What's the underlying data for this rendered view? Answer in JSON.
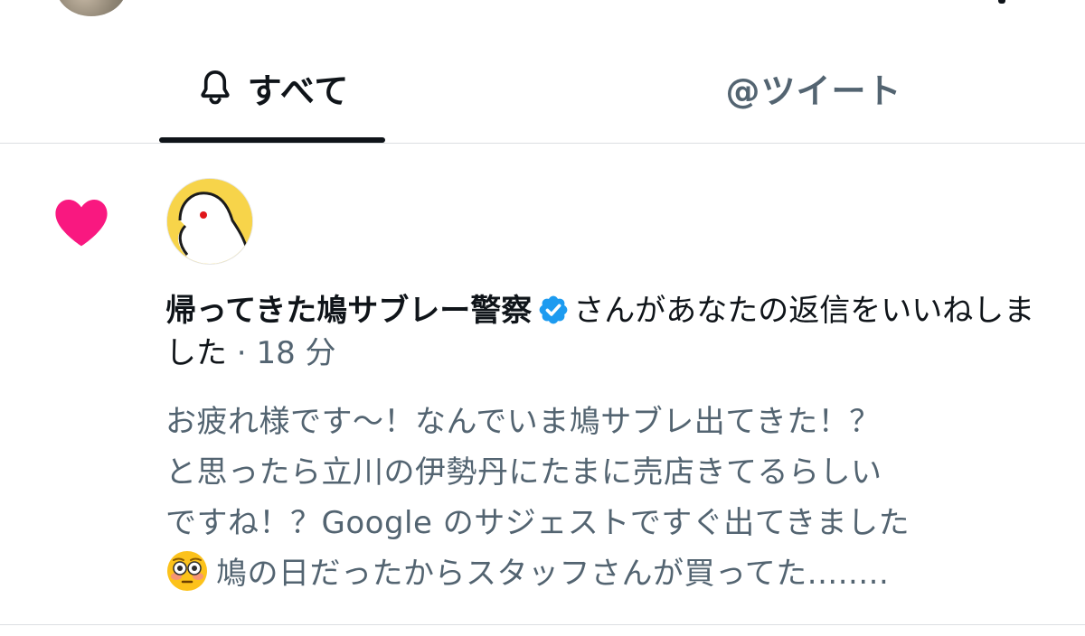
{
  "top": {
    "avatar_icon": "user-avatar"
  },
  "tabs": [
    {
      "label": "すべて",
      "icon": "bell-icon",
      "active": true
    },
    {
      "label": "@ツイート",
      "active": false
    }
  ],
  "notification": {
    "type_icon": "heart-icon",
    "type_color": "#f91880",
    "actor": "帰ってきた鳩サブレー警察",
    "verified": true,
    "action": "さんがあなたの返信をいいねしました",
    "separator": " · ",
    "time": "18 分",
    "tweet_lines": [
      "お疲れ様です〜！なんでいま鳩サブレ出てきた！？",
      "と思ったら立川の伊勢丹にたまに売店きてるらしい",
      "ですね！？Google のサジェストですぐ出てきました",
      "鳩の日だったからスタッフさんが買ってた........"
    ],
    "emoji_icon": "flushed-face-emoji"
  },
  "colors": {
    "accent": "#1d9bf0",
    "secondary_text": "#536471",
    "primary_text": "#0f1419",
    "like": "#f91880"
  }
}
